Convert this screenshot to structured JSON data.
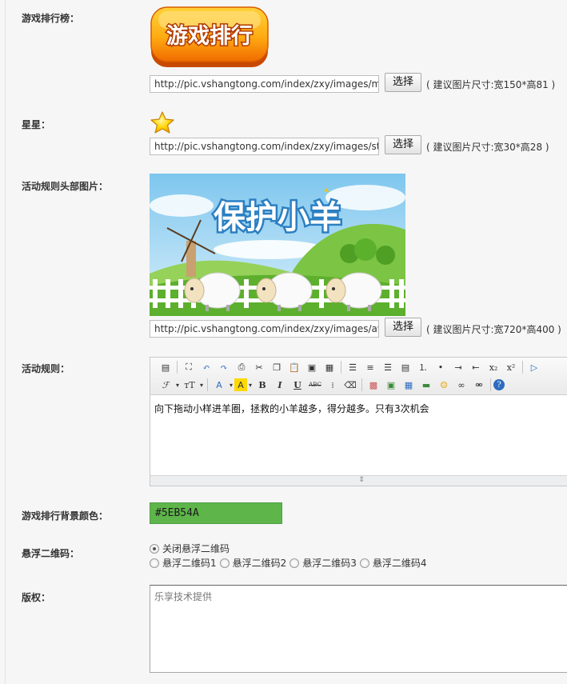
{
  "rank": {
    "label": "游戏排行榜：",
    "image_text": "游戏排行",
    "url": "http://pic.vshangtong.com/index/zxy/images/mc",
    "choose": "选择",
    "hint": "( 建议图片尺寸:宽150*高81 )"
  },
  "star": {
    "label": "星星：",
    "url": "http://pic.vshangtong.com/index/zxy/images/sta",
    "choose": "选择",
    "hint": "( 建议图片尺寸:宽30*高28 )"
  },
  "header_image": {
    "label": "活动规则头部图片：",
    "image_text": "保护小羊",
    "url": "http://pic.vshangtong.com/index/zxy/images/avg",
    "choose": "选择",
    "hint": "( 建议图片尺寸:宽720*高400 )"
  },
  "rules": {
    "label": "活动规则：",
    "content": "向下拖动小样进羊圈，拯救的小羊越多，得分越多。只有3次机会",
    "resize_handle": "⇕"
  },
  "bg_color": {
    "label": "游戏排行背景颜色：",
    "value": "#5EB54A",
    "swatch": "#5eb54a"
  },
  "qrcode": {
    "label": "悬浮二维码：",
    "options": [
      {
        "label": "关闭悬浮二维码",
        "selected": true
      },
      {
        "label": "悬浮二维码1",
        "selected": false
      },
      {
        "label": "悬浮二维码2",
        "selected": false
      },
      {
        "label": "悬浮二维码3",
        "selected": false
      },
      {
        "label": "悬浮二维码4",
        "selected": false
      }
    ]
  },
  "copyright": {
    "label": "版权：",
    "value": "乐享技术提供"
  },
  "toolbar": {
    "font_family": "ℱ",
    "font_size": "тT",
    "font_color": "A",
    "highlight": "A",
    "bold": "B",
    "italic": "I",
    "underline": "U",
    "strike": "ABC",
    "subscript": "x₂",
    "superscript": "x²"
  }
}
